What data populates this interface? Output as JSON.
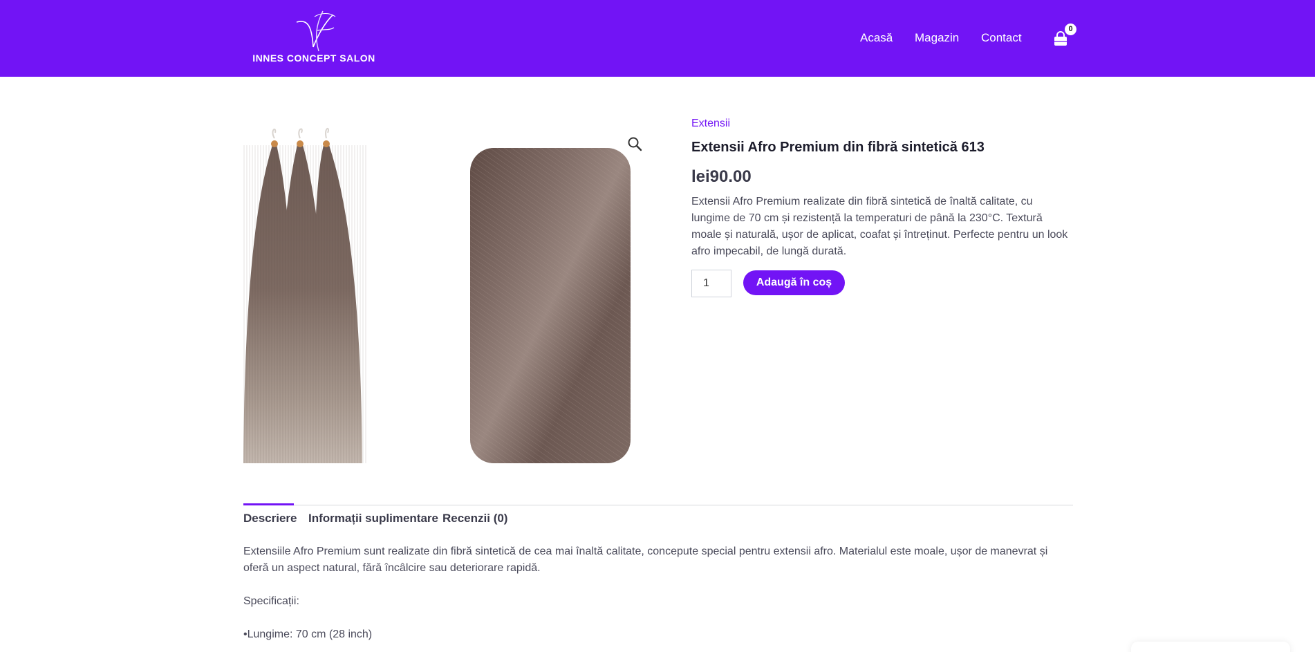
{
  "header": {
    "logo_text": "INNES CONCEPT SALON",
    "logo_monogram": "IC",
    "bg_color": "#7214f5",
    "nav": [
      {
        "label": "Acasă"
      },
      {
        "label": "Magazin"
      },
      {
        "label": "Contact"
      }
    ],
    "cart": {
      "icon": "shopping-bag-icon",
      "count": "0"
    }
  },
  "product": {
    "category": "Extensii",
    "title": "Extensii Afro Premium din fibră sintetică 613",
    "price": "lei90.00",
    "short_description": "Extensii Afro Premium realizate din fibră sintetică de înaltă calitate, cu lungime de 70 cm și rezistență la temperaturi de până la 230°C. Textură moale și naturală, ușor de aplicat, coafat și întreținut. Perfecte pentru un look afro impecabil, de lungă durată.",
    "quantity": "1",
    "add_to_cart_label": "Adaugă în coș",
    "zoom_icon": "magnifier-icon",
    "accent_color": "#7214f5"
  },
  "tabs": [
    {
      "label": "Descriere",
      "active": true
    },
    {
      "label": "Informații suplimentare",
      "active": false
    },
    {
      "label": "Recenzii (0)",
      "active": false
    }
  ],
  "description": {
    "paragraph": "Extensiile Afro Premium sunt realizate din fibră sintetică de cea mai înaltă calitate, concepute special pentru extensii afro. Materialul este moale, ușor de manevrat și oferă un aspect natural, fără încâlcire sau deteriorare rapidă.",
    "spec_heading": "Specificații:",
    "spec_1": "•Lungime: 70 cm (28 inch)"
  }
}
